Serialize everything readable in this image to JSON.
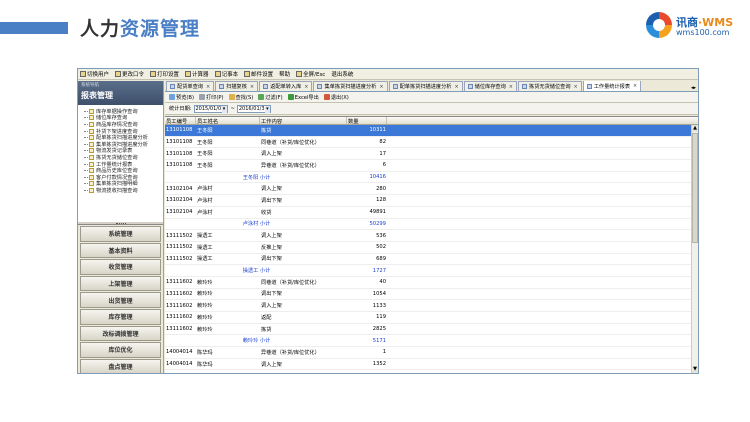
{
  "slide": {
    "title_dark": "人力",
    "title_highlight": "资源管理",
    "logo_text": "讯商",
    "logo_suffix": "·WMS",
    "logo_url": "wms100.com"
  },
  "menubar": [
    {
      "label": "切换用户",
      "icon": "user-switch-icon"
    },
    {
      "label": "更改口令",
      "icon": "key-icon"
    },
    {
      "label": "打印设置",
      "icon": "printer-icon"
    },
    {
      "label": "计算器",
      "icon": "calculator-icon"
    },
    {
      "label": "记事本",
      "icon": "notepad-icon"
    },
    {
      "label": "邮件设置",
      "icon": "mail-icon"
    },
    {
      "label": "帮助",
      "icon": ""
    },
    {
      "label": "全屏/Esc",
      "icon": "fullscreen-icon"
    },
    {
      "label": "退出系统",
      "icon": ""
    }
  ],
  "sidebar": {
    "small": "系统导航",
    "title": "报表管理",
    "tree": [
      "库存单据操作查询",
      "储位库存查询",
      "商品库存情况查询",
      "补货下架进度查询",
      "配单拣货扫描进度分析",
      "集单拣货扫描进度分析",
      "物流发货记录表",
      "拣货无货储位查询",
      "工作量统计报表",
      "商品历史库位查询",
      "客户付款情况查询",
      "集单拣货扫描明细",
      "物流揽收扫描查询"
    ],
    "nav": [
      "系统管理",
      "基本资料",
      "收货管理",
      "上架管理",
      "出货管理",
      "库存管理",
      "改标调拨管理",
      "库位优化",
      "盘点管理",
      "报表管理"
    ],
    "active_nav": 9
  },
  "tabs": [
    {
      "label": "配货单查询"
    },
    {
      "label": "扫描复核"
    },
    {
      "label": "返配单转入库"
    },
    {
      "label": "集单拣货扫描进度分析"
    },
    {
      "label": "配单拣货扫描进度分析"
    },
    {
      "label": "储位库存查询"
    },
    {
      "label": "拣货无货储位查询"
    },
    {
      "label": "工作量统计报表"
    }
  ],
  "active_tab": 7,
  "toolbar": [
    {
      "label": "预览(B)",
      "icon": "preview-icon",
      "color": "#6fa3e0"
    },
    {
      "label": "打印(P)",
      "icon": "print-icon",
      "color": "#9aa3ad"
    },
    {
      "label": "查找(S)",
      "icon": "find-icon",
      "color": "#e0b14a"
    },
    {
      "label": "过滤(F)",
      "icon": "filter-icon",
      "color": "#56a856"
    },
    {
      "label": "Excel导出",
      "icon": "excel-icon",
      "color": "#3c9a3c"
    },
    {
      "label": "退出(X)",
      "icon": "exit-icon",
      "color": "#d25a3a"
    }
  ],
  "filter": {
    "label": "统计日期:",
    "from": "2015/01/01",
    "to": "2016/01/31",
    "sep": "~"
  },
  "grid": {
    "columns": [
      "员工编号",
      "员工姓名",
      "工作内容",
      "数量"
    ],
    "rows": [
      {
        "type": "data",
        "id": "13101108",
        "name": "王冬阳",
        "work": "拣货",
        "qty": "10311",
        "selected": true
      },
      {
        "type": "data",
        "id": "13101108",
        "name": "王冬阳",
        "work": "同巷道（补货/库位优化）",
        "qty": "82"
      },
      {
        "type": "data",
        "id": "13101108",
        "name": "王冬阳",
        "work": "调入上架",
        "qty": "17"
      },
      {
        "type": "data",
        "id": "13101108",
        "name": "王冬阳",
        "work": "异巷道（补货/库位优化）",
        "qty": "6"
      },
      {
        "type": "sub",
        "label": "王冬阳 小计",
        "qty": "10416"
      },
      {
        "type": "data",
        "id": "13102104",
        "name": "卢泳村",
        "work": "调入上架",
        "qty": "280"
      },
      {
        "type": "data",
        "id": "13102104",
        "name": "卢泳村",
        "work": "调出下架",
        "qty": "128"
      },
      {
        "type": "data",
        "id": "13102104",
        "name": "卢泳村",
        "work": "收货",
        "qty": "49891"
      },
      {
        "type": "sub",
        "label": "卢泳村 小计",
        "qty": "50299"
      },
      {
        "type": "data",
        "id": "13111502",
        "name": "操透工",
        "work": "调入上架",
        "qty": "536"
      },
      {
        "type": "data",
        "id": "13111502",
        "name": "操透工",
        "work": "反推上架",
        "qty": "502"
      },
      {
        "type": "data",
        "id": "13111502",
        "name": "操透工",
        "work": "调出下架",
        "qty": "689"
      },
      {
        "type": "sub",
        "label": "操透工 小计",
        "qty": "1727"
      },
      {
        "type": "data",
        "id": "13111602",
        "name": "赖玲玲",
        "work": "同巷道（补货/库位优化）",
        "qty": "40"
      },
      {
        "type": "data",
        "id": "13111602",
        "name": "赖玲玲",
        "work": "调出下架",
        "qty": "1054"
      },
      {
        "type": "data",
        "id": "13111602",
        "name": "赖玲玲",
        "work": "调入上架",
        "qty": "1133"
      },
      {
        "type": "data",
        "id": "13111602",
        "name": "赖玲玲",
        "work": "返配",
        "qty": "119"
      },
      {
        "type": "data",
        "id": "13111602",
        "name": "赖玲玲",
        "work": "拣货",
        "qty": "2825"
      },
      {
        "type": "sub",
        "label": "赖玲玲 小计",
        "qty": "5171"
      },
      {
        "type": "data",
        "id": "14004014",
        "name": "陈华玛",
        "work": "异巷道（补货/库位优化）",
        "qty": "1"
      },
      {
        "type": "data",
        "id": "14004014",
        "name": "陈华玛",
        "work": "调入上架",
        "qty": "1352"
      }
    ]
  },
  "colors": {
    "accent": "#4a7fc6",
    "selected_row": "#3b78d8",
    "subtotal_text": "#1a3fd0"
  }
}
